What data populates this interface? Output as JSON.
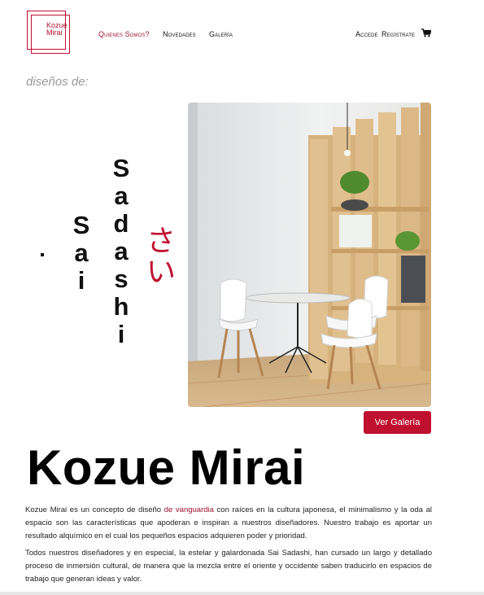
{
  "logo": {
    "line1": "Kozue",
    "line2": "Mirai"
  },
  "nav": {
    "quienes": "Quienes Somos?",
    "novedades": "Novedades",
    "galeria": "Galería",
    "accede": "Accede",
    "registrate": "Regístrate",
    "cart_icon": "shopping-cart-icon"
  },
  "hero": {
    "kicker": "diseños de:",
    "name_first": "Sai",
    "name_last": "Sadashi",
    "kana": "さい",
    "cta": "Ver Galería"
  },
  "brand": {
    "title": "Kozue Mirai"
  },
  "body": {
    "p1_start": "Kozue Mirai es un concepto de diseño ",
    "p1_link": "de vanguardia",
    "p1_end": " con raíces en la cultura japonesa, el minimalismo y la oda al espacio son las características que apoderan e inspiran a nuestros diseñadores. Nuestro trabajo es aportar un resultado alquímico en el cual los pequeños espacios adquieren poder y prioridad.",
    "p2": "Todos nuestros diseñadores y en especial, la estelar y galardonada Sai Sadashi, han cursado un largo y detallado proceso de inmersión cultural, de manera que la mezcla entre el oriente y occidente saben traducirlo en espacios de trabajo que generan ideas y valor."
  },
  "colors": {
    "accent": "#c0102f",
    "link": "#9c1230"
  }
}
